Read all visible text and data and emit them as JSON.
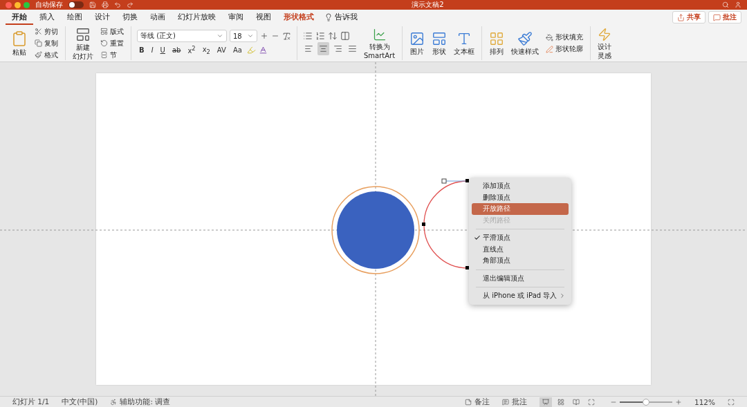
{
  "title_bar": {
    "autosave_label": "自动保存",
    "autosave_on": false,
    "title": "演示文稿2"
  },
  "tabs": [
    {
      "label": "开始",
      "selected": true,
      "contextual": false
    },
    {
      "label": "插入",
      "selected": false,
      "contextual": false
    },
    {
      "label": "绘图",
      "selected": false,
      "contextual": false
    },
    {
      "label": "设计",
      "selected": false,
      "contextual": false
    },
    {
      "label": "切换",
      "selected": false,
      "contextual": false
    },
    {
      "label": "动画",
      "selected": false,
      "contextual": false
    },
    {
      "label": "幻灯片放映",
      "selected": false,
      "contextual": false
    },
    {
      "label": "审阅",
      "selected": false,
      "contextual": false
    },
    {
      "label": "视图",
      "selected": false,
      "contextual": false
    },
    {
      "label": "形状格式",
      "selected": false,
      "contextual": true
    }
  ],
  "tell_me": {
    "label": "告诉我"
  },
  "header_buttons": [
    {
      "kind": "share",
      "label": "共享"
    },
    {
      "kind": "comments",
      "label": "批注"
    }
  ],
  "ribbon": {
    "clipboard": {
      "paste": "粘贴",
      "cut": "剪切",
      "copy": "复制",
      "format": "格式"
    },
    "slides": {
      "new_slide": [
        "新建",
        "幻灯片"
      ],
      "layout": "版式",
      "reset": "重置",
      "section": "节"
    },
    "font": {
      "name": "等线 (正文)",
      "size": "18",
      "format_buttons": [
        {
          "label": "B",
          "kind": "bold"
        },
        {
          "label": "I",
          "kind": "italic"
        },
        {
          "label": "U",
          "kind": "underline"
        },
        {
          "label": "ab",
          "kind": "strike"
        },
        {
          "label": "x$^{2}$",
          "kind": "plain"
        },
        {
          "label": "x$_{2}$",
          "kind": "plain"
        },
        {
          "label": "AV",
          "kind": "plain"
        },
        {
          "label": "Aa",
          "kind": "plain"
        }
      ]
    },
    "paragraph": {
      "alignments": [
        {
          "kind": "left",
          "selected": false
        },
        {
          "kind": "center",
          "selected": true
        },
        {
          "kind": "right",
          "selected": false
        },
        {
          "kind": "justify",
          "selected": false
        }
      ],
      "smartart": [
        "转换为",
        "SmartArt"
      ]
    },
    "insert": [
      {
        "kind": "picture",
        "label": "图片"
      },
      {
        "kind": "shape",
        "label": "形状"
      },
      {
        "kind": "textbox",
        "label": "文本框"
      }
    ],
    "arrange": {
      "arrange": "排列",
      "quick_styles": "快速样式",
      "fill": "形状填充",
      "outline": "形状轮廓"
    },
    "designer": [
      "设计",
      "灵感"
    ]
  },
  "context_menu": [
    {
      "kind": "item",
      "label": "添加顶点",
      "selected": false,
      "disabled": false,
      "checked": false,
      "submenu": false
    },
    {
      "kind": "item",
      "label": "删除顶点",
      "selected": false,
      "disabled": false,
      "checked": false,
      "submenu": false
    },
    {
      "kind": "item",
      "label": "开放路径",
      "selected": true,
      "disabled": false,
      "checked": false,
      "submenu": false
    },
    {
      "kind": "item",
      "label": "关闭路径",
      "selected": false,
      "disabled": true,
      "checked": false,
      "submenu": false
    },
    {
      "kind": "separator"
    },
    {
      "kind": "item",
      "label": "平滑顶点",
      "selected": false,
      "disabled": false,
      "checked": true,
      "submenu": false
    },
    {
      "kind": "item",
      "label": "直线点",
      "selected": false,
      "disabled": false,
      "checked": false,
      "submenu": false
    },
    {
      "kind": "item",
      "label": "角部顶点",
      "selected": false,
      "disabled": false,
      "checked": false,
      "submenu": false
    },
    {
      "kind": "separator"
    },
    {
      "kind": "item",
      "label": "退出编辑顶点",
      "selected": false,
      "disabled": false,
      "checked": false,
      "submenu": false
    },
    {
      "kind": "separator"
    },
    {
      "kind": "item",
      "label": "从 iPhone 或 iPad 导入",
      "selected": false,
      "disabled": false,
      "checked": false,
      "submenu": true
    }
  ],
  "status_bar": {
    "slide": "幻灯片 1/1",
    "language": "中文(中国)",
    "accessibility": "辅助功能: 调查",
    "notes": "备注",
    "comments": "批注",
    "views": [
      {
        "kind": "normal",
        "selected": true
      },
      {
        "kind": "sorter",
        "selected": false
      },
      {
        "kind": "reading",
        "selected": false
      },
      {
        "kind": "show",
        "selected": false
      }
    ],
    "zoom": {
      "level": 0.5,
      "reading": "112%"
    }
  }
}
